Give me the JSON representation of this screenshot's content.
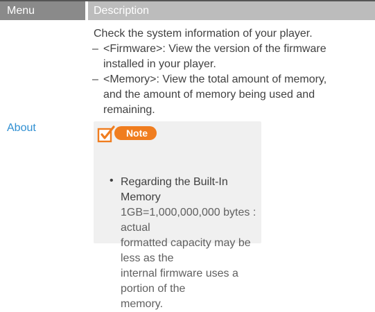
{
  "header": {
    "menu_label": "Menu",
    "description_label": "Description"
  },
  "row": {
    "menu_item": "About",
    "description": {
      "intro": "Check the system information of your player.",
      "bullets": [
        {
          "dash": "–",
          "lines": [
            "<Firmware>: View the version of the firmware",
            "installed in your player."
          ]
        },
        {
          "dash": "–",
          "lines": [
            "<Memory>: View the total amount of memory,",
            "and the amount of memory being used and",
            "remaining."
          ]
        }
      ]
    },
    "note": {
      "label": "Note",
      "bullet": "•",
      "title": "Regarding the Built-In Memory",
      "body_lines": [
        "1GB=1,000,000,000 bytes : actual",
        "formatted capacity may be less as the",
        "internal firmware uses a portion of the",
        "memory."
      ]
    }
  },
  "colors": {
    "menu_header_bg": "#8a8a8a",
    "description_header_bg": "#bcbcbc",
    "menu_item_text": "#2f8fd2",
    "note_accent": "#f07d1f",
    "note_box_bg": "#f0f0f0"
  }
}
